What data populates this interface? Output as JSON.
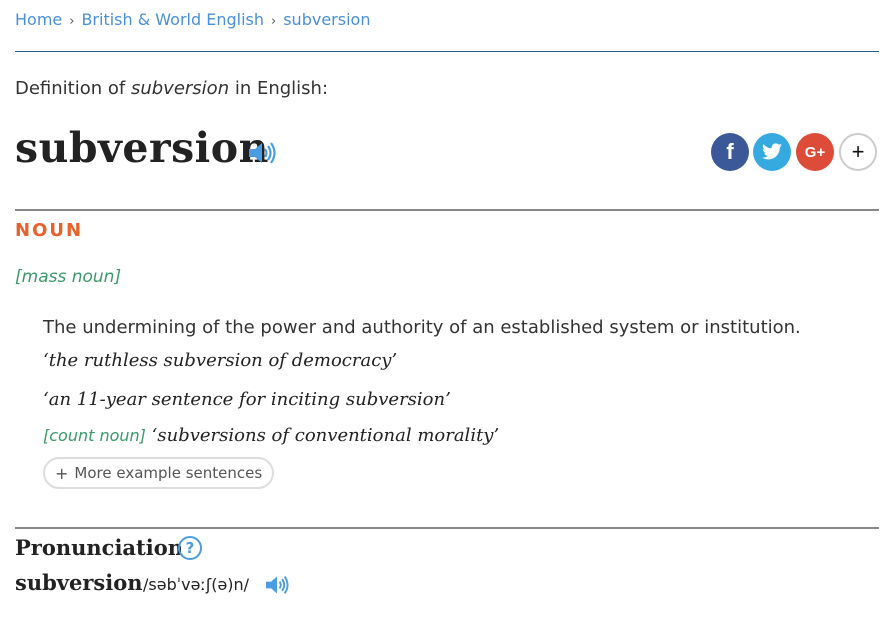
{
  "breadcrumb": {
    "items": [
      "Home",
      "British & World English",
      "subversion"
    ],
    "separator": "›"
  },
  "definition_of": {
    "prefix": "Definition of ",
    "word": "subversion",
    "suffix": " in English:"
  },
  "headword": "subversion",
  "icons": {
    "audio": "speaker-icon",
    "help": "question-circle-icon"
  },
  "social": {
    "facebook": "f",
    "twitter": "🐦",
    "google_plus": "G+",
    "more": "+"
  },
  "entry": {
    "part_of_speech": "NOUN",
    "grammar_note": "[mass noun]",
    "definition": "The undermining of the power and authority of an established system or institution.",
    "examples": [
      {
        "grammar": "",
        "text": "‘the ruthless subversion of democracy’"
      },
      {
        "grammar": "",
        "text": "‘an 11-year sentence for inciting subversion’"
      },
      {
        "grammar": "[count noun]",
        "text": "‘subversions of conventional morality’"
      }
    ],
    "more_examples_label": "More example sentences",
    "more_examples_icon": "+"
  },
  "pronunciation": {
    "heading": "Pronunciation",
    "help_glyph": "?",
    "word": "subversion",
    "ipa": "/səbˈvəːʃ(ə)n/"
  },
  "colors": {
    "link": "#4a90d9",
    "pos": "#e8602c",
    "grammar": "#3a9a6a",
    "facebook": "#3b5998",
    "twitter": "#36a9e1",
    "google_plus": "#dd4b39"
  }
}
